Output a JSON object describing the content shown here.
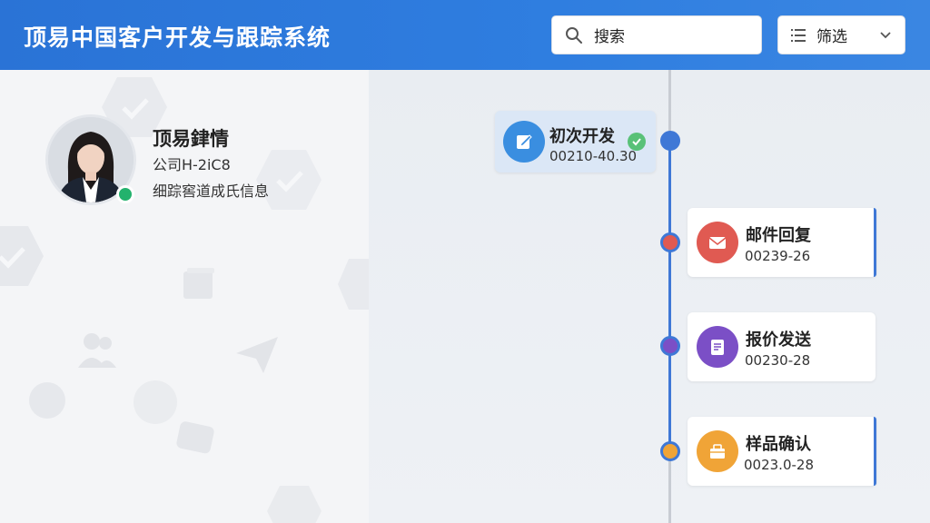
{
  "header": {
    "title": "顶易中国客户开发与跟踪系统",
    "search_placeholder": "搜索",
    "filter_label": "筛选"
  },
  "contact": {
    "name": "顶易銉情",
    "company": "公司H-2iC8",
    "description": "细踪窖道成氏信息",
    "status_color": "#23b26d"
  },
  "timeline": {
    "events": [
      {
        "title": "初次开发",
        "date": "00210-40.30",
        "icon": "note-icon",
        "color": "#3a8ee0",
        "completed": true
      },
      {
        "title": "邮件回复",
        "date": "00239-26",
        "icon": "envelope-icon",
        "color": "#e05a52"
      },
      {
        "title": "报价发送",
        "date": "00230-28",
        "icon": "document-icon",
        "color": "#7b4fc6"
      },
      {
        "title": "样品确认",
        "date": "0023.0-28",
        "icon": "box-icon",
        "color": "#f0a437"
      }
    ]
  }
}
